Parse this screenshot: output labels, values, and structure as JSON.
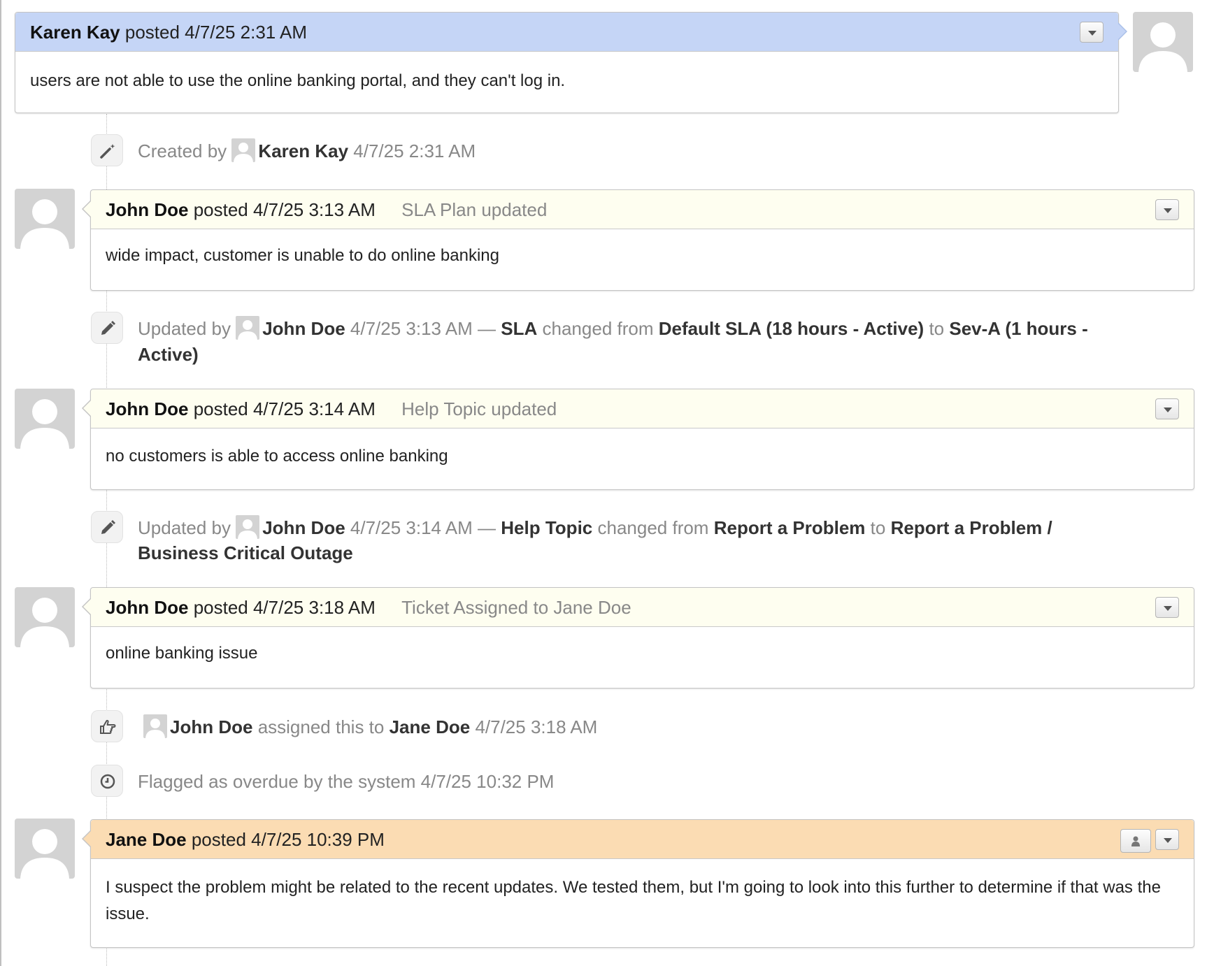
{
  "colors": {
    "customer_header": "#c5d5f6",
    "agent_header": "#fefef0",
    "internal_note_header": "#fbdcb3",
    "event_text": "#888888"
  },
  "icons": {
    "created": "magic-wand-icon",
    "updated": "pencil-icon",
    "assigned": "hand-point-right-icon",
    "overdue": "clock-icon",
    "avatar": "user-silhouette-icon",
    "menu": "chevron-down-icon",
    "internal": "person-icon"
  },
  "thread": {
    "m1": {
      "author": "Karen Kay",
      "posted": "posted 4/7/25 2:31 AM",
      "body": "users are not able to use the online banking portal, and they can't log in."
    },
    "e1": {
      "prefix": "Created by",
      "user": "Karen Kay",
      "time": "4/7/25 2:31 AM"
    },
    "m2": {
      "author": "John Doe",
      "posted": "posted 4/7/25 3:13 AM",
      "title": "SLA Plan updated",
      "body": "wide impact, customer is unable to do online banking"
    },
    "e2": {
      "prefix": "Updated by",
      "user": "John Doe",
      "time": "4/7/25 3:13 AM —",
      "field": "SLA",
      "changed": "changed from",
      "from": "Default SLA (18 hours - Active)",
      "to_word": "to",
      "to": "Sev-A (1 hours - Active)"
    },
    "m3": {
      "author": "John Doe",
      "posted": "posted 4/7/25 3:14 AM",
      "title": "Help Topic updated",
      "body": "no customers is able to access online banking"
    },
    "e3": {
      "prefix": "Updated by",
      "user": "John Doe",
      "time": "4/7/25 3:14 AM —",
      "field": "Help Topic",
      "changed": "changed from",
      "from": "Report a Problem",
      "to_word": "to",
      "to": "Report a Problem / Business Critical Outage"
    },
    "m4": {
      "author": "John Doe",
      "posted": "posted 4/7/25 3:18 AM",
      "title": "Ticket Assigned to Jane Doe",
      "body": "online banking issue"
    },
    "e4": {
      "user": "John Doe",
      "action": "assigned this to",
      "target": "Jane Doe",
      "time": "4/7/25 3:18 AM"
    },
    "e5": {
      "text": "Flagged as overdue by the system 4/7/25 10:32 PM"
    },
    "m5": {
      "author": "Jane Doe",
      "posted": "posted 4/7/25 10:39 PM",
      "body": "I suspect the problem might be related to the recent updates. We tested them, but I'm going to look into this further to determine if that was the issue."
    }
  }
}
